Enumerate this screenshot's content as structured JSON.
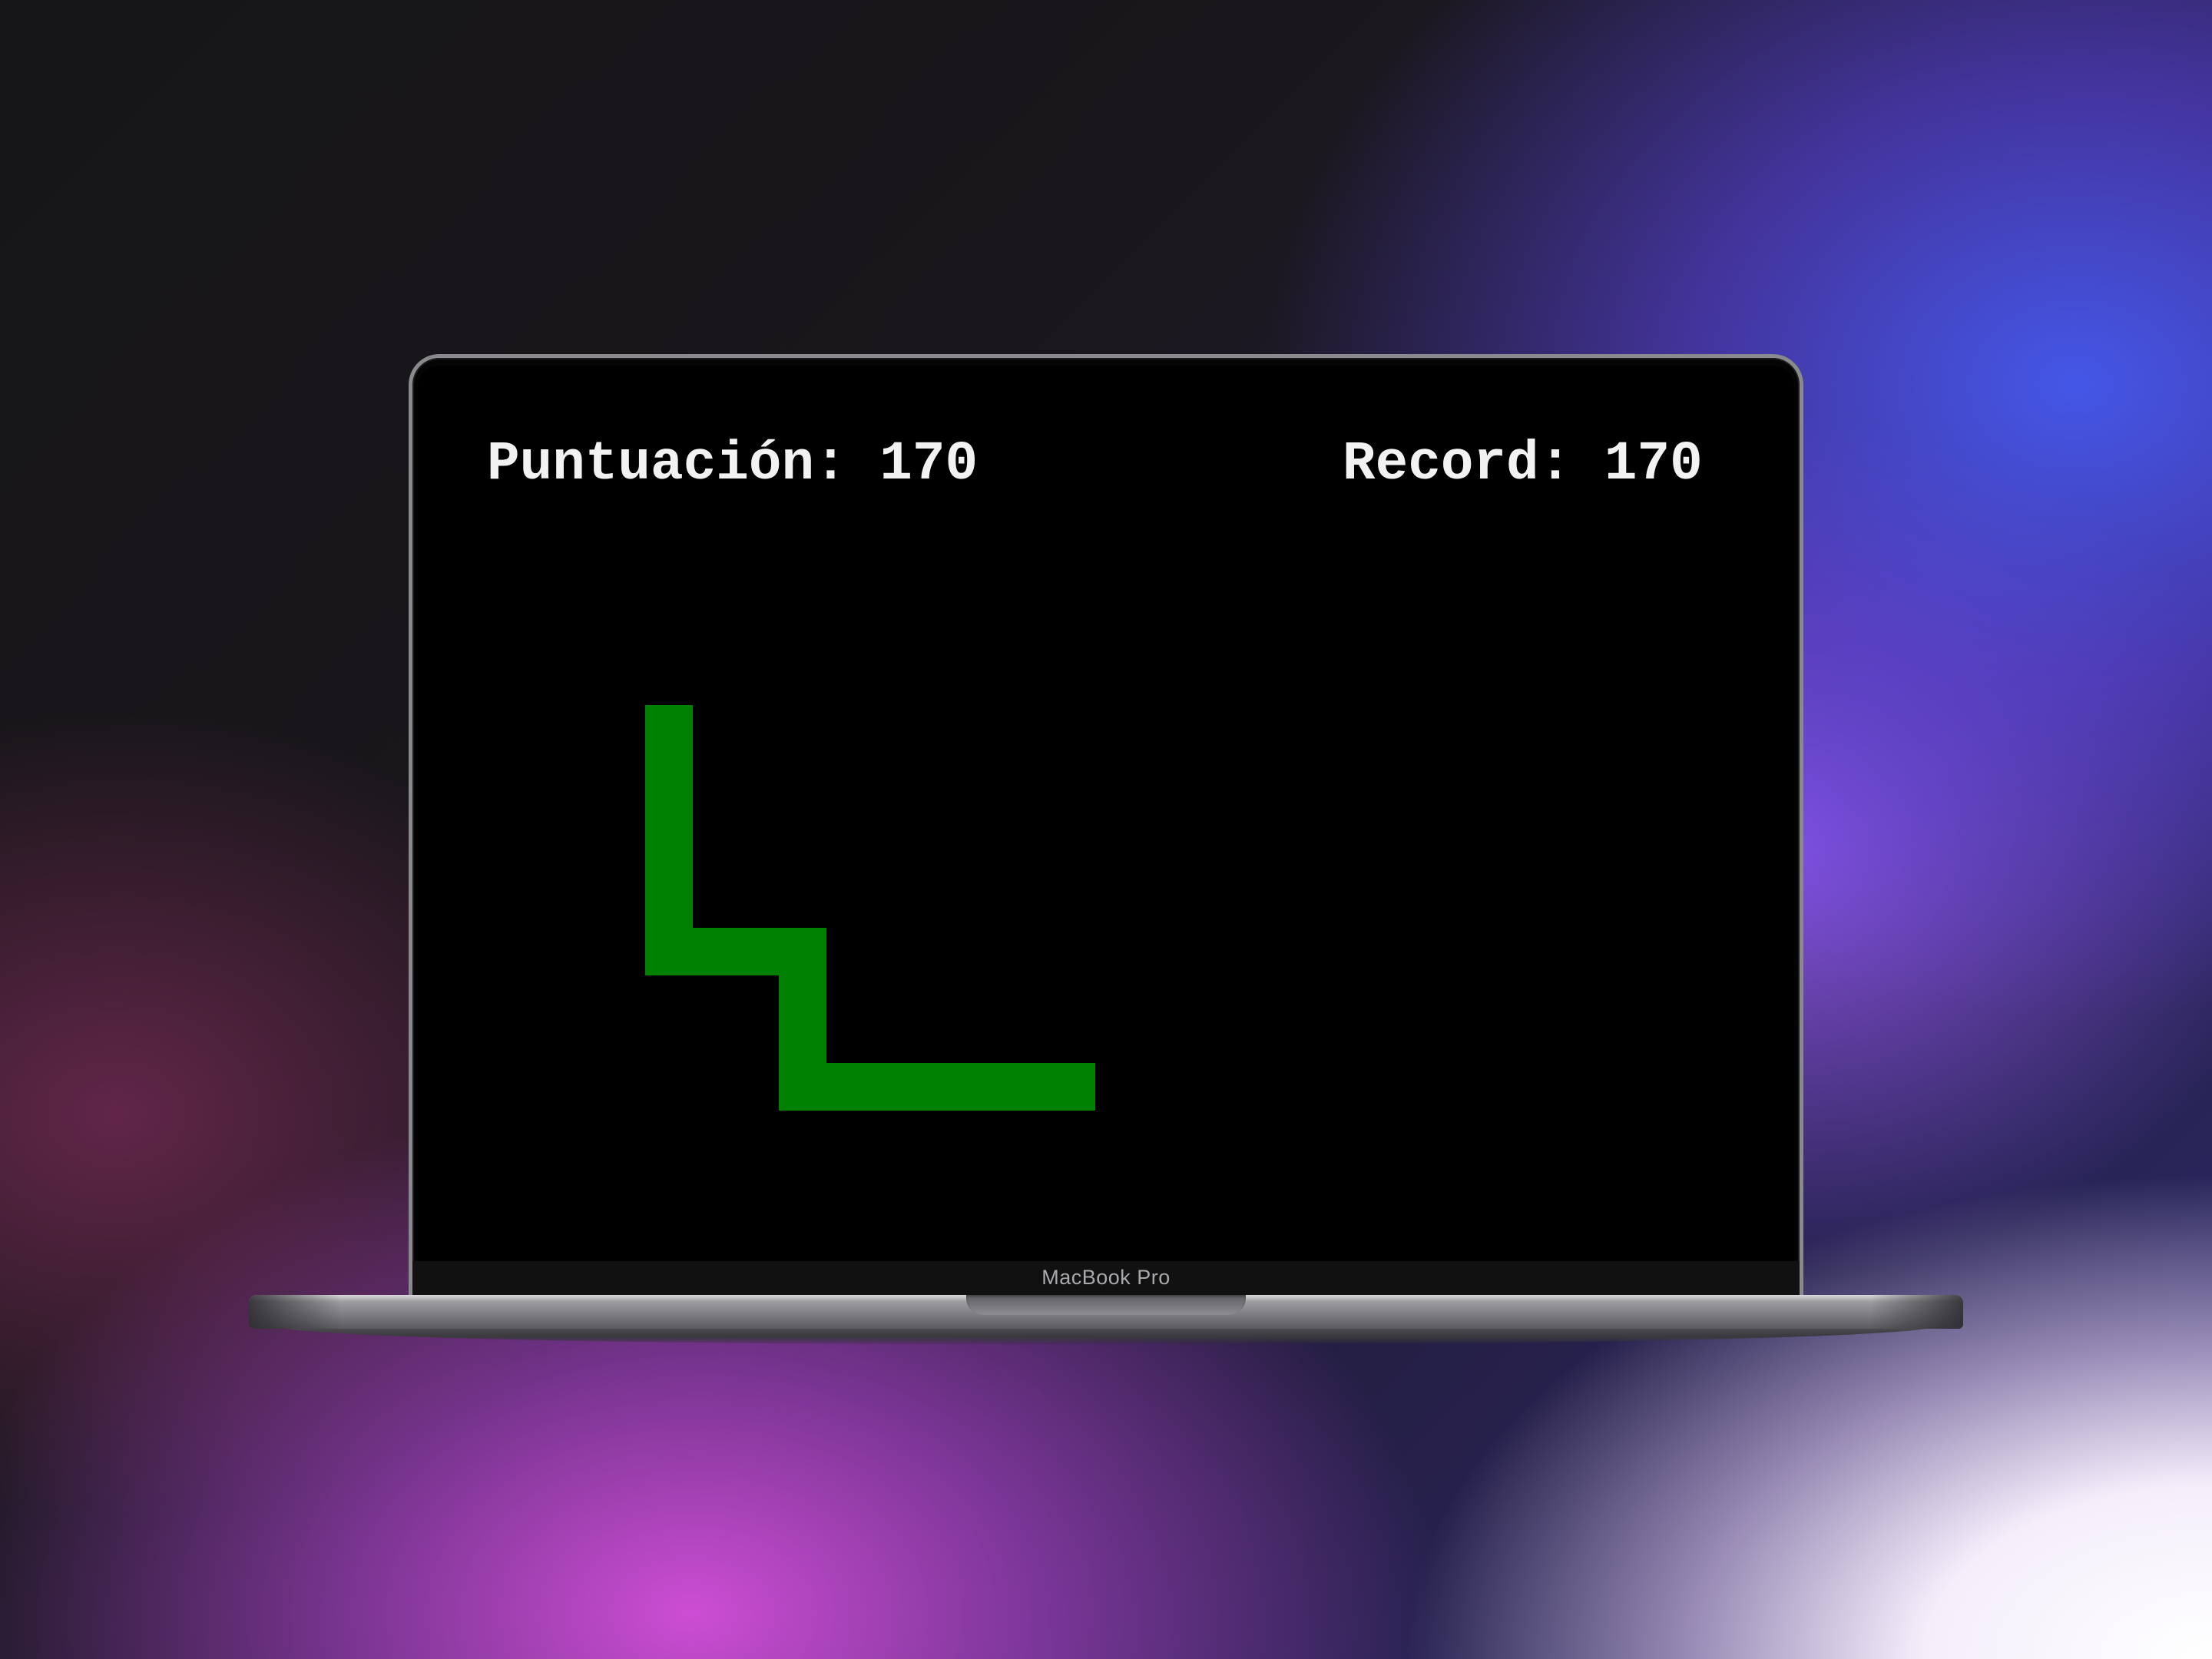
{
  "game": {
    "score_text": "Puntuación: 170",
    "record_text": "Record: 170",
    "score": 170,
    "record": 170,
    "snake_color": "#008000",
    "background_color": "#000000"
  },
  "device": {
    "model_label": "MacBook Pro"
  }
}
